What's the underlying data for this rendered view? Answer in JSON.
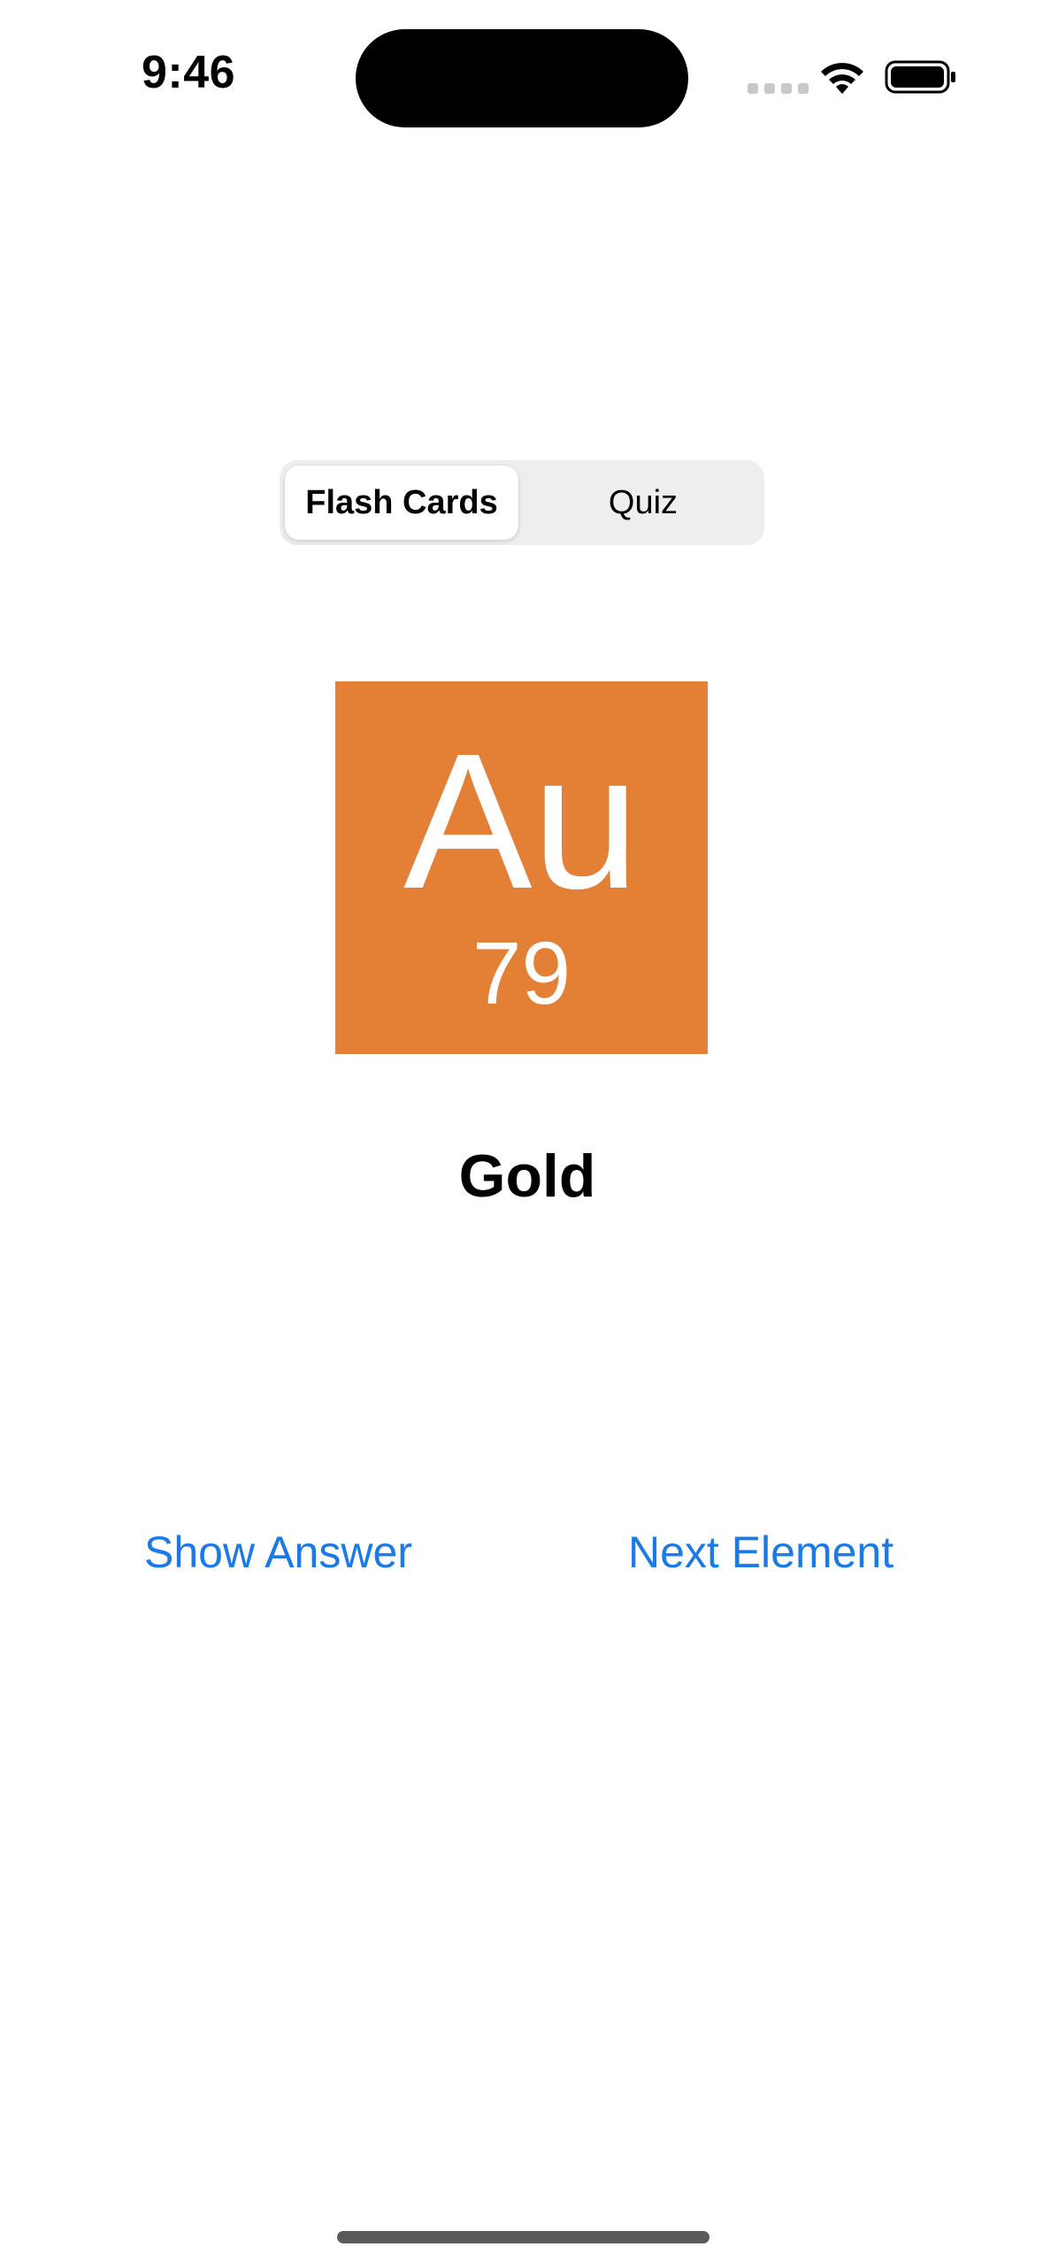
{
  "status_bar": {
    "time": "9:46"
  },
  "segmented_control": {
    "items": [
      {
        "label": "Flash Cards",
        "selected": true
      },
      {
        "label": "Quiz",
        "selected": false
      }
    ]
  },
  "card": {
    "symbol": "Au",
    "atomic_number": "79",
    "name": "Gold",
    "tile_color": "#e38035"
  },
  "actions": {
    "show_answer_label": "Show Answer",
    "next_element_label": "Next Element",
    "link_color": "#1a7ae8"
  },
  "icons": [
    "wifi-icon",
    "battery-icon",
    "cellular-signal-icon"
  ]
}
